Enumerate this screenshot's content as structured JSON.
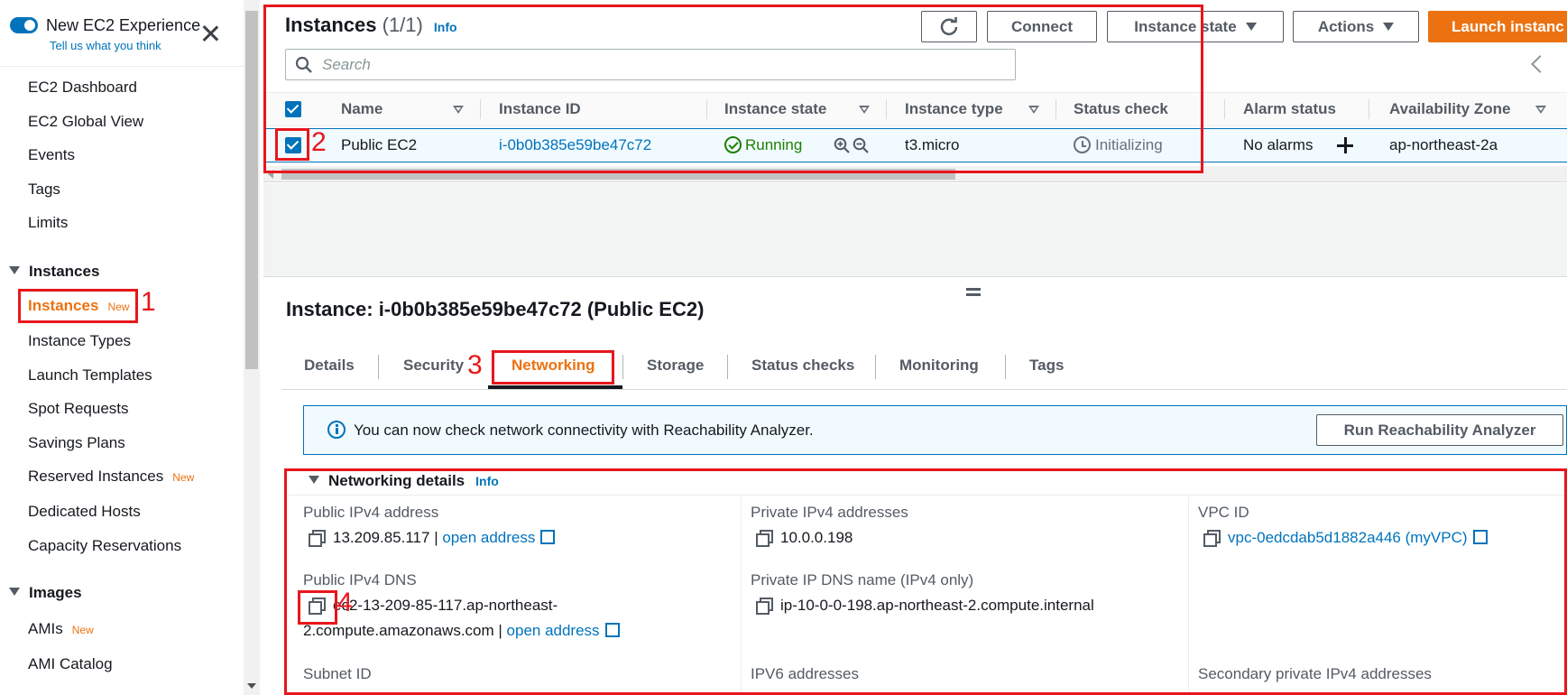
{
  "sidebar": {
    "new_experience_title": "New EC2 Experience",
    "new_experience_sub": "Tell us what you think",
    "items_top": [
      "EC2 Dashboard",
      "EC2 Global View",
      "Events",
      "Tags",
      "Limits"
    ],
    "section_instances": "Instances",
    "instances_items": [
      {
        "label": "Instances",
        "badge": "New"
      },
      {
        "label": "Instance Types"
      },
      {
        "label": "Launch Templates"
      },
      {
        "label": "Spot Requests"
      },
      {
        "label": "Savings Plans"
      },
      {
        "label": "Reserved Instances",
        "badge": "New"
      },
      {
        "label": "Dedicated Hosts"
      },
      {
        "label": "Capacity Reservations"
      }
    ],
    "section_images": "Images",
    "images_items": [
      {
        "label": "AMIs",
        "badge": "New"
      },
      {
        "label": "AMI Catalog"
      }
    ]
  },
  "header": {
    "title": "Instances",
    "count": "(1/1)",
    "info": "Info",
    "buttons": {
      "connect": "Connect",
      "instance_state": "Instance state",
      "actions": "Actions",
      "launch": "Launch instanc"
    },
    "search_placeholder": "Search"
  },
  "table": {
    "columns": [
      "Name",
      "Instance ID",
      "Instance state",
      "Instance type",
      "Status check",
      "Alarm status",
      "Availability Zone"
    ],
    "row": {
      "name": "Public EC2",
      "instance_id": "i-0b0b385e59be47c72",
      "state": "Running",
      "type": "t3.micro",
      "status_check": "Initializing",
      "alarm_status": "No alarms",
      "availability_zone": "ap-northeast-2a"
    }
  },
  "details": {
    "title": "Instance: i-0b0b385e59be47c72 (Public EC2)",
    "tabs": [
      "Details",
      "Security",
      "Networking",
      "Storage",
      "Status checks",
      "Monitoring",
      "Tags"
    ],
    "active_tab": "Networking",
    "banner_text": "You can now check network connectivity with Reachability Analyzer.",
    "banner_button": "Run Reachability Analyzer",
    "section_title": "Networking details",
    "section_info": "Info",
    "fields": {
      "public_ipv4_label": "Public IPv4 address",
      "public_ipv4_value": "13.209.85.117",
      "open_address": "open address",
      "private_ipv4_label": "Private IPv4 addresses",
      "private_ipv4_value": "10.0.0.198",
      "vpc_label": "VPC ID",
      "vpc_value": "vpc-0edcdab5d1882a446 (myVPC)",
      "public_dns_label": "Public IPv4 DNS",
      "public_dns_value_1": "ec2-13-209-85-117.ap-northeast-",
      "public_dns_value_2": "2.compute.amazonaws.com",
      "private_dns_label": "Private IP DNS name (IPv4 only)",
      "private_dns_value": "ip-10-0-0-198.ap-northeast-2.compute.internal",
      "subnet_label": "Subnet ID",
      "ipv6_label": "IPV6 addresses",
      "secondary_label": "Secondary private IPv4 addresses"
    }
  },
  "annotations": [
    "1",
    "2",
    "3",
    "4"
  ],
  "colors": {
    "accent_orange": "#ec7211",
    "link_blue": "#0073bb",
    "running_green": "#1d8102",
    "annotation_red": "#e8161c"
  }
}
